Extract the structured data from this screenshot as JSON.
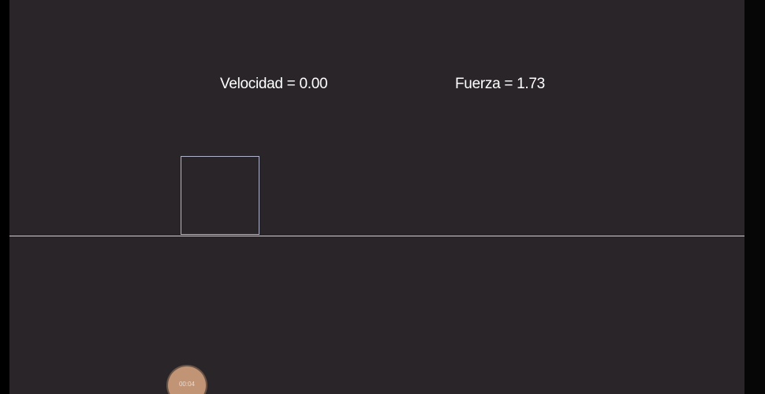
{
  "simulation": {
    "velocity_text": "Velocidad = 0.00",
    "force_text": "Fuerza = 1.73",
    "velocity_value": 0.0,
    "force_value": 1.73
  },
  "timer": {
    "label": "00:04"
  },
  "colors": {
    "background": "#2a2529",
    "ground_line": "#c8d2c8",
    "block_outline": "#b0b4c8",
    "text": "#ffffff",
    "timer_badge": "#c19476"
  }
}
